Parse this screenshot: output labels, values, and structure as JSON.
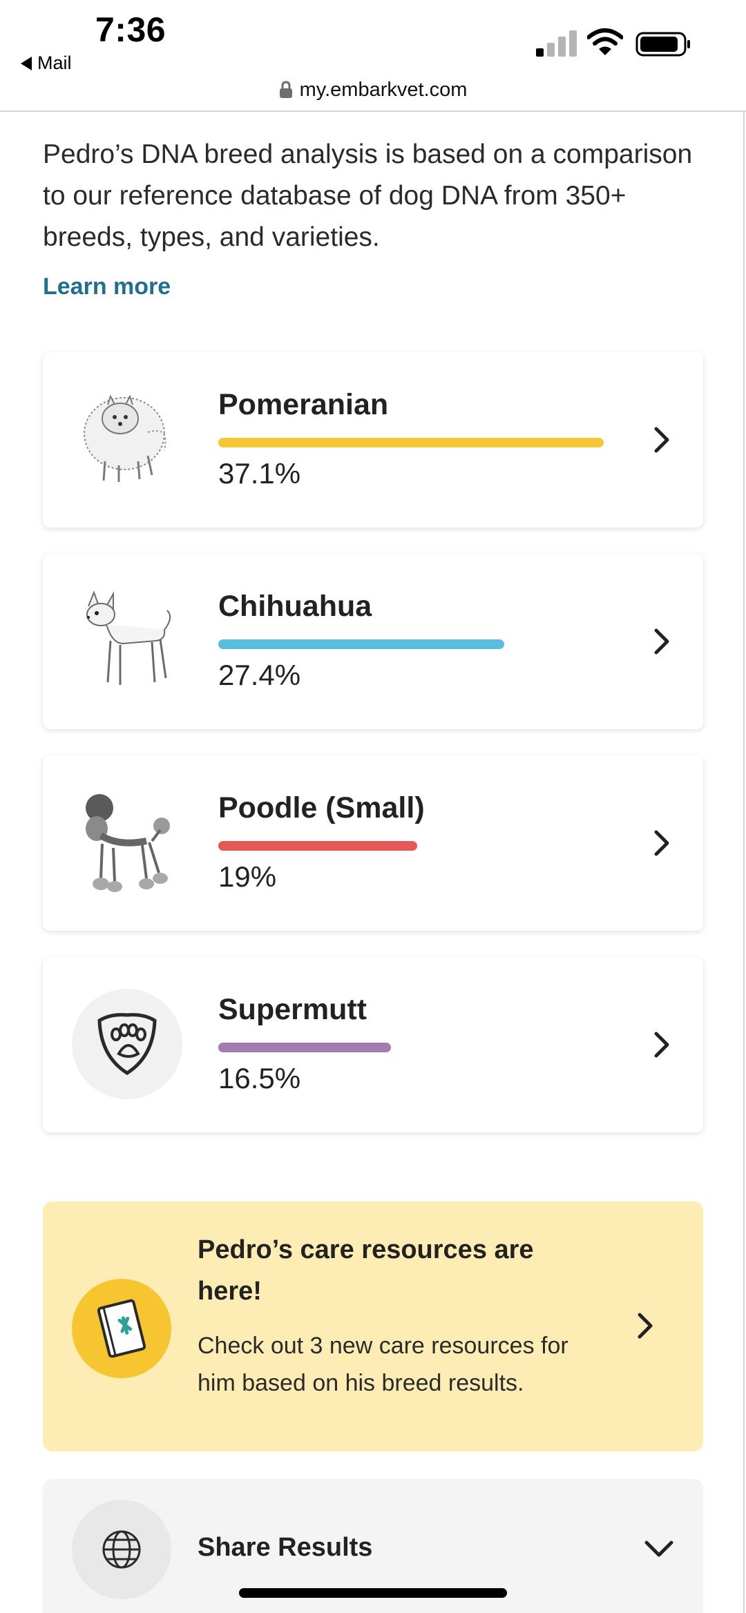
{
  "status_bar": {
    "time": "7:36",
    "back_label": "Mail"
  },
  "browser": {
    "url": "my.embarkvet.com"
  },
  "intro": {
    "text": "Pedro’s DNA breed analysis is based on a comparison to our reference database of dog DNA from 350+ breeds, types, and varieties.",
    "link": "Learn more"
  },
  "breeds": [
    {
      "name": "Pomeranian",
      "percent_label": "37.1%",
      "percent": 37.1,
      "color": "#f5c636",
      "icon": "pomeranian-illustration"
    },
    {
      "name": "Chihuahua",
      "percent_label": "27.4%",
      "percent": 27.4,
      "color": "#59bde0",
      "icon": "chihuahua-illustration"
    },
    {
      "name": "Poodle (Small)",
      "percent_label": "19%",
      "percent": 19,
      "color": "#e45858",
      "icon": "poodle-illustration"
    },
    {
      "name": "Supermutt",
      "percent_label": "16.5%",
      "percent": 16.5,
      "color": "#a27bb0",
      "icon": "paw-shield-icon"
    }
  ],
  "care": {
    "title": "Pedro’s care resources are here!",
    "body": "Check out 3 new care resources for him based on his breed results.",
    "bg_color": "#fdedb5",
    "icon": "care-book-icon"
  },
  "share": {
    "label": "Share Results",
    "icon": "globe-icon"
  }
}
